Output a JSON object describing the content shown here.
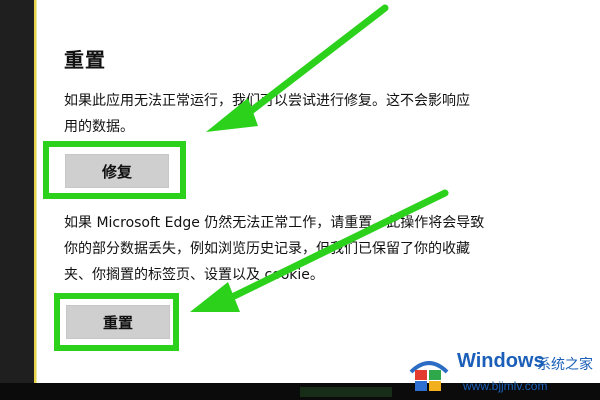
{
  "reset_section": {
    "title": "重置",
    "repair_description_line1": "如果此应用无法正常运行，我们可以尝试进行修复。这不会影响应",
    "repair_description_line2": "用的数据。",
    "repair_button_label": "修复",
    "reset_description_line1": "如果 Microsoft Edge 仍然无法正常工作，请重置。此操作将会导致",
    "reset_description_line2": "你的部分数据丢失，例如浏览历史记录，但我们已保留了你的收藏",
    "reset_description_line3": "夹、你搁置的标签页、设置以及 cookie。",
    "reset_button_label": "重置"
  },
  "watermark": {
    "brand_word": "Windows",
    "brand_cn": "系统之家",
    "url": "www.bjjmlv.com"
  },
  "colors": {
    "highlight_green": "#2bd11b",
    "button_gray": "#cfcfcf",
    "brand_blue": "#1b5fb8"
  }
}
